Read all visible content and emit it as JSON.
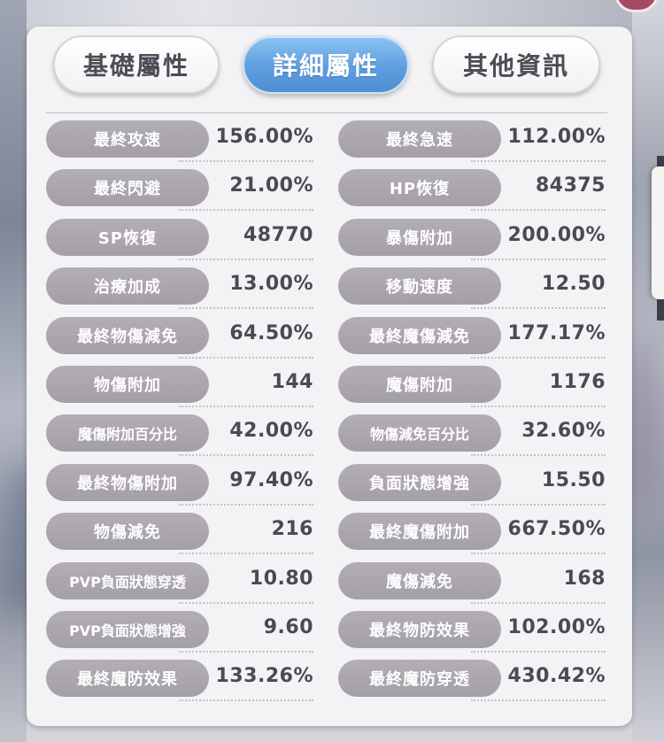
{
  "tabs": [
    {
      "label": "基礎屬性",
      "active": false
    },
    {
      "label": "詳細屬性",
      "active": true
    },
    {
      "label": "其他資訊",
      "active": false
    }
  ],
  "rows": [
    [
      {
        "label": "最終攻速",
        "value": "156.00%"
      },
      {
        "label": "最終急速",
        "value": "112.00%"
      }
    ],
    [
      {
        "label": "最終閃避",
        "value": "21.00%"
      },
      {
        "label": "HP恢復",
        "value": "84375"
      }
    ],
    [
      {
        "label": "SP恢復",
        "value": "48770"
      },
      {
        "label": "暴傷附加",
        "value": "200.00%"
      }
    ],
    [
      {
        "label": "治療加成",
        "value": "13.00%"
      },
      {
        "label": "移動速度",
        "value": "12.50"
      }
    ],
    [
      {
        "label": "最終物傷減免",
        "value": "64.50%"
      },
      {
        "label": "最終魔傷減免",
        "value": "177.17%"
      }
    ],
    [
      {
        "label": "物傷附加",
        "value": "144"
      },
      {
        "label": "魔傷附加",
        "value": "1176"
      }
    ],
    [
      {
        "label": "魔傷附加百分比",
        "value": "42.00%"
      },
      {
        "label": "物傷減免百分比",
        "value": "32.60%"
      }
    ],
    [
      {
        "label": "最終物傷附加",
        "value": "97.40%"
      },
      {
        "label": "負面狀態增強",
        "value": "15.50"
      }
    ],
    [
      {
        "label": "物傷減免",
        "value": "216"
      },
      {
        "label": "最終魔傷附加",
        "value": "667.50%"
      }
    ],
    [
      {
        "label": "PVP負面狀態穿透",
        "value": "10.80"
      },
      {
        "label": "魔傷減免",
        "value": "168"
      }
    ],
    [
      {
        "label": "PVP負面狀態增強",
        "value": "9.60"
      },
      {
        "label": "最終物防效果",
        "value": "102.00%"
      }
    ],
    [
      {
        "label": "最終魔防效果",
        "value": "133.26%"
      },
      {
        "label": "最終魔防穿透",
        "value": "430.42%"
      }
    ]
  ],
  "colors": {
    "active_tab": "#5e9edf",
    "pill": "#a9a4ac",
    "value_text": "#4c4954",
    "panel": "#f3f3f5"
  }
}
